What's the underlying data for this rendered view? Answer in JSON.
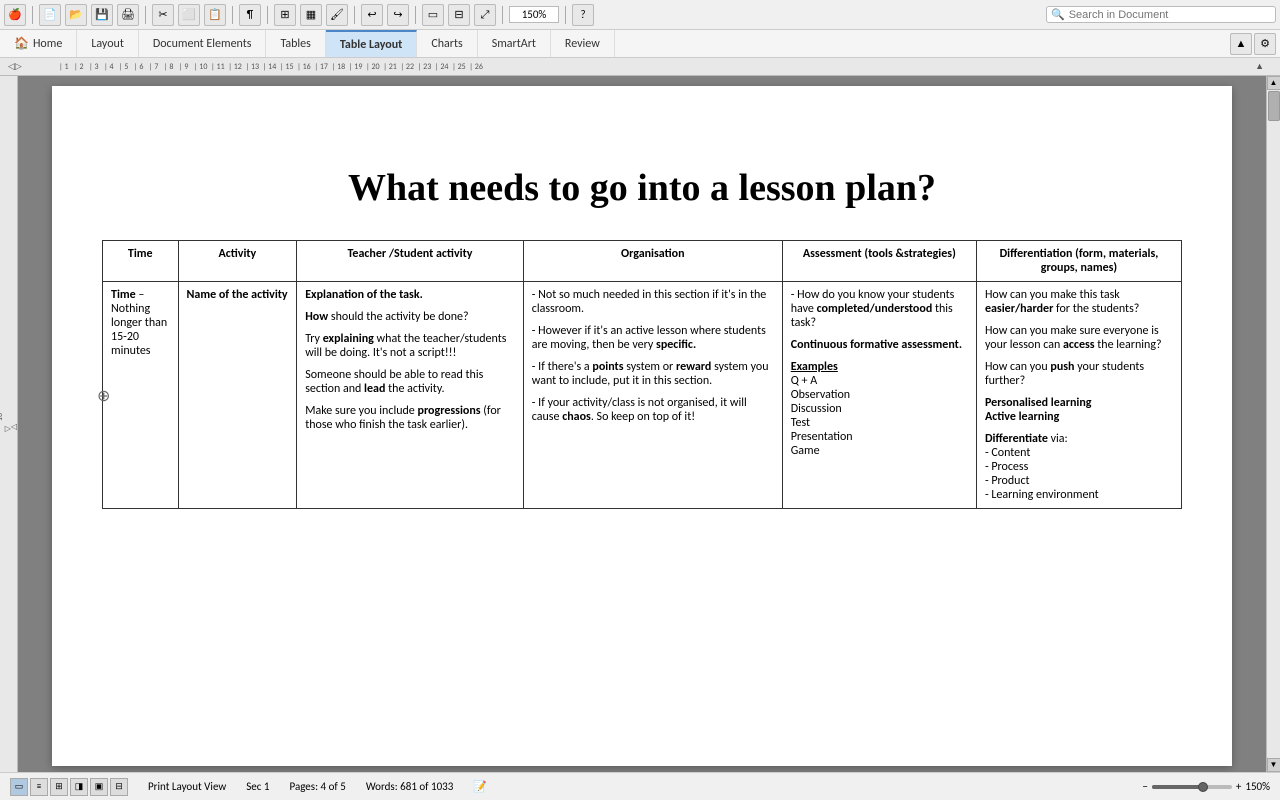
{
  "toolbar": {
    "zoom_value": "150%",
    "search_placeholder": "Search in Document"
  },
  "ribbon": {
    "tabs": [
      {
        "label": "Home",
        "active": false
      },
      {
        "label": "Layout",
        "active": false
      },
      {
        "label": "Document Elements",
        "active": false
      },
      {
        "label": "Tables",
        "active": false
      },
      {
        "label": "Table Layout",
        "active": true
      },
      {
        "label": "Charts",
        "active": false
      },
      {
        "label": "SmartArt",
        "active": false
      },
      {
        "label": "Review",
        "active": false
      }
    ]
  },
  "document": {
    "title": "What needs to go into a lesson plan?",
    "table": {
      "headers": [
        "Time",
        "Activity",
        "Teacher /Student activity",
        "Organisation",
        "Assessment (tools &strategies)",
        "Differentiation (form, materials, groups, names)"
      ],
      "row": {
        "time": "Time – Nothing longer than 15-20 minutes",
        "activity": "Name of the activity",
        "teacher_content": [
          "Explanation of the task.",
          "How should the activity be done?",
          "Try explaining what the teacher/students will be doing. It's not a script!!!",
          "Someone should be able to read this section and lead the activity.",
          "Make sure you include progressions (for those who finish the task earlier)."
        ],
        "organisation_content": [
          "- Not so much needed in this section if it's in the classroom.",
          "- However if it's an active lesson where students are moving, then be very specific.",
          "- If there's a points system or reward system you want to include, put it in this section.",
          "- If your activity/class is not organised, it will cause chaos. So keep on top of it!"
        ],
        "assessment_content": {
          "intro": "- How do you know your students have completed/understood this task?",
          "continuous": "Continuous formative assessment.",
          "examples_label": "Examples",
          "examples_list": [
            "Q + A",
            "Observation",
            "Discussion",
            "Test",
            "Presentation",
            "Game"
          ]
        },
        "diff_content": {
          "line1": "How can you make this task easier/harder for the students?",
          "line2": "How can you make sure everyone is your lesson can access the learning?",
          "line3": "How can you push your students further?",
          "personalised": "Personalised learning",
          "active": "Active learning",
          "differentiate_label": "Differentiate via:",
          "diff_list": [
            "- Content",
            "- Process",
            "- Product",
            "- Learning environment"
          ]
        }
      }
    }
  },
  "status_bar": {
    "view_label": "Print Layout View",
    "sec_label": "Sec",
    "sec_value": "1",
    "pages_label": "Pages:",
    "pages_value": "4 of 5",
    "words_label": "Words:",
    "words_value": "681 of 1033",
    "zoom_value": "150%"
  }
}
